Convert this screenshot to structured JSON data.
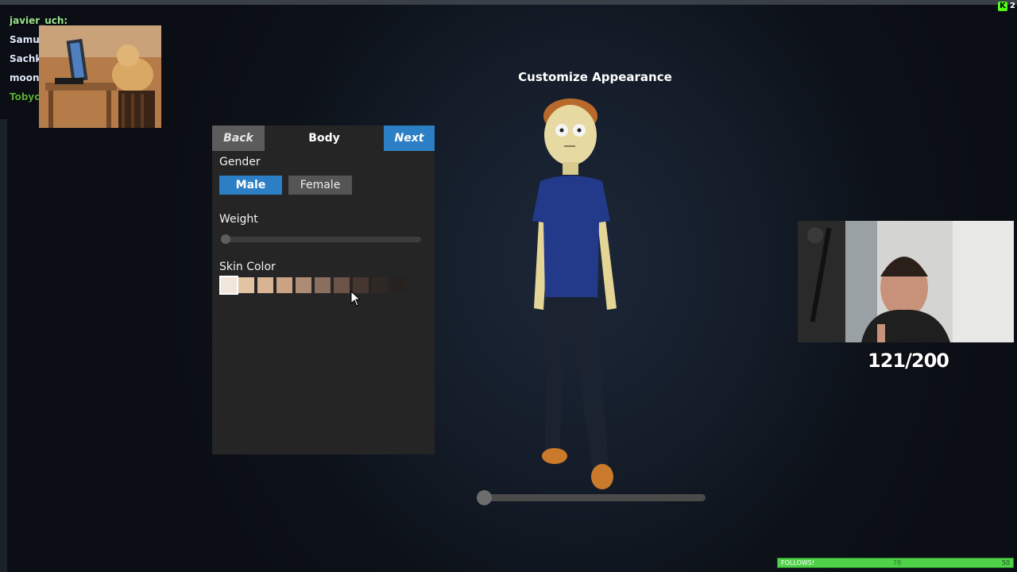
{
  "title": "Customize Appearance",
  "chat": {
    "users": [
      "javier_uch:",
      "Samu",
      "Sachk",
      "moon",
      "Tobyc"
    ]
  },
  "panel": {
    "back_label": "Back",
    "section_title": "Body",
    "next_label": "Next",
    "gender": {
      "label": "Gender",
      "options": [
        "Male",
        "Female"
      ],
      "selected": "Male"
    },
    "weight": {
      "label": "Weight",
      "value": 0.0
    },
    "skin_color": {
      "label": "Skin Color",
      "swatches": [
        "#f1e6dc",
        "#e2c3a4",
        "#d8b394",
        "#c9a384",
        "#ad8b75",
        "#8a6f5f",
        "#6b5446",
        "#453730",
        "#2f2723",
        "#262220"
      ],
      "selected_index": 0
    }
  },
  "rotation": {
    "value": 0.0
  },
  "stream_overlay": {
    "goal_counter": "121/200",
    "k_count": "2",
    "follows": {
      "label": "FOLLOWS!",
      "current": "78",
      "goal": "50"
    }
  },
  "colors": {
    "accent": "#2c7fc4",
    "panel_bg": "#252525",
    "follows_bar": "#4fd24a"
  }
}
